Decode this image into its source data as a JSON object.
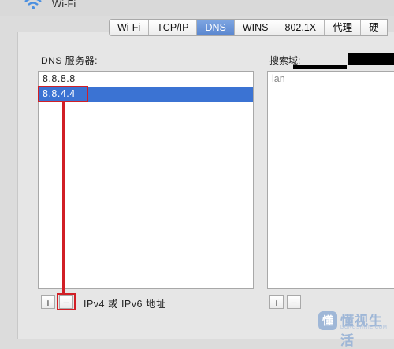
{
  "window": {
    "title": "Wi-Fi",
    "icon": "wifi-icon"
  },
  "tabs": [
    {
      "label": "Wi-Fi",
      "active": false
    },
    {
      "label": "TCP/IP",
      "active": false
    },
    {
      "label": "DNS",
      "active": true
    },
    {
      "label": "WINS",
      "active": false
    },
    {
      "label": "802.1X",
      "active": false
    },
    {
      "label": "代理",
      "active": false
    },
    {
      "label": "硬",
      "active": false
    }
  ],
  "dns": {
    "label": "DNS 服务器:",
    "servers": [
      "8.8.8.8",
      "8.8.4.4"
    ],
    "selected_index": 1,
    "add_label": "+",
    "remove_label": "−",
    "hint": "IPv4 或 IPv6 地址"
  },
  "search": {
    "label": "搜索域:",
    "domains": [
      "lan"
    ],
    "add_label": "+",
    "remove_label": "−"
  },
  "watermark": {
    "text": "懂视生活",
    "sub": "DONGSHIJIE.COM",
    "icon_glyph": "懂"
  },
  "colors": {
    "selection": "#3b73d3",
    "annotation_red": "#d11f26",
    "active_tab": "#5a86cf"
  }
}
